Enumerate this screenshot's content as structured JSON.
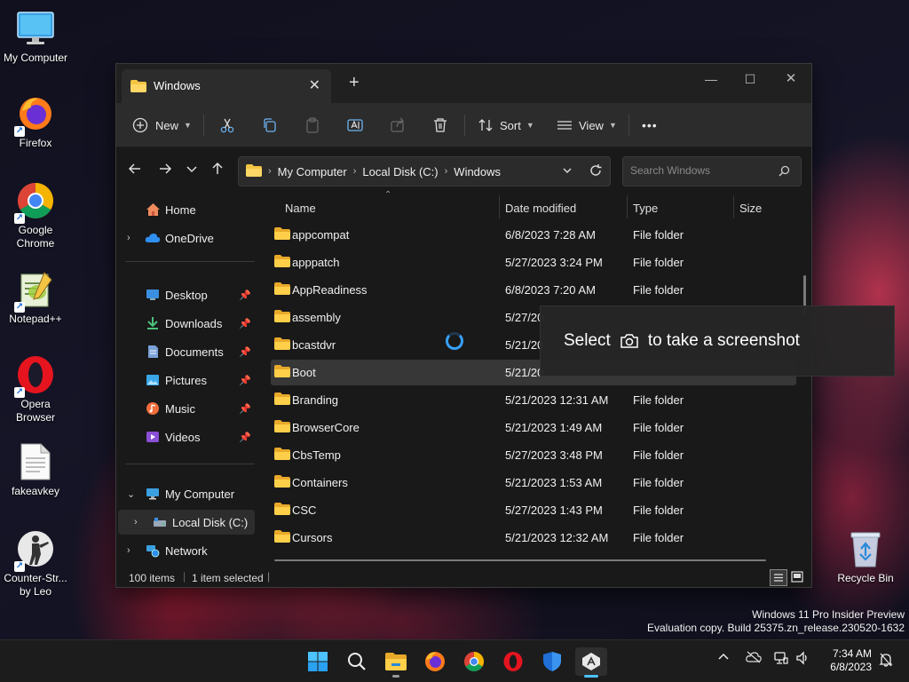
{
  "desktop": {
    "icons": [
      {
        "label": "My Computer"
      },
      {
        "label": "Firefox"
      },
      {
        "label": "Google\nChrome"
      },
      {
        "label": "Notepad++"
      },
      {
        "label": "Opera\nBrowser"
      },
      {
        "label": "fakeavkey"
      },
      {
        "label": "Counter-Str...\nby Leo"
      },
      {
        "label": "Recycle Bin"
      }
    ]
  },
  "window": {
    "tab_title": "Windows",
    "toolbar": {
      "new_label": "New",
      "sort_label": "Sort",
      "view_label": "View",
      "more_label": "•••"
    },
    "address": {
      "crumbs": [
        "My Computer",
        "Local Disk (C:)",
        "Windows"
      ]
    },
    "search": {
      "placeholder": "Search Windows"
    },
    "sidebar": {
      "home": "Home",
      "onedrive": "OneDrive",
      "quick": [
        "Desktop",
        "Downloads",
        "Documents",
        "Pictures",
        "Music",
        "Videos"
      ],
      "mycomputer": "My Computer",
      "localdisk": "Local Disk (C:)",
      "network": "Network"
    },
    "columns": {
      "name": "Name",
      "date": "Date modified",
      "type": "Type",
      "size": "Size"
    },
    "rows": [
      {
        "name": "appcompat",
        "date": "6/8/2023 7:28 AM",
        "type": "File folder"
      },
      {
        "name": "apppatch",
        "date": "5/27/2023 3:24 PM",
        "type": "File folder"
      },
      {
        "name": "AppReadiness",
        "date": "6/8/2023 7:20 AM",
        "type": "File folder"
      },
      {
        "name": "assembly",
        "date": "5/27/20",
        "type": ""
      },
      {
        "name": "bcastdvr",
        "date": "5/21/20",
        "type": ""
      },
      {
        "name": "Boot",
        "date": "5/21/20",
        "type": ""
      },
      {
        "name": "Branding",
        "date": "5/21/2023 12:31 AM",
        "type": "File folder"
      },
      {
        "name": "BrowserCore",
        "date": "5/21/2023 1:49 AM",
        "type": "File folder"
      },
      {
        "name": "CbsTemp",
        "date": "5/27/2023 3:48 PM",
        "type": "File folder"
      },
      {
        "name": "Containers",
        "date": "5/21/2023 1:53 AM",
        "type": "File folder"
      },
      {
        "name": "CSC",
        "date": "5/27/2023 1:43 PM",
        "type": "File folder"
      },
      {
        "name": "Cursors",
        "date": "5/21/2023 12:32 AM",
        "type": "File folder"
      }
    ],
    "selected_index": 5,
    "status": {
      "items": "100 items",
      "selected": "1 item selected"
    }
  },
  "tooltip": {
    "before": "Select",
    "after": "to take a screenshot"
  },
  "watermark": {
    "line1": "Windows 11 Pro Insider Preview",
    "line2": "Evaluation copy. Build 25375.zn_release.230520-1632"
  },
  "taskbar": {
    "icons": [
      "start-icon",
      "search-icon",
      "file-explorer-icon",
      "firefox-icon",
      "chrome-icon",
      "opera-icon",
      "defender-icon",
      "snipping-tool-icon"
    ],
    "time": "7:34 AM",
    "date": "6/8/2023"
  },
  "colors": {
    "accent": "#39a0ff",
    "folder": "#f4c542",
    "window_bg": "#191919"
  }
}
